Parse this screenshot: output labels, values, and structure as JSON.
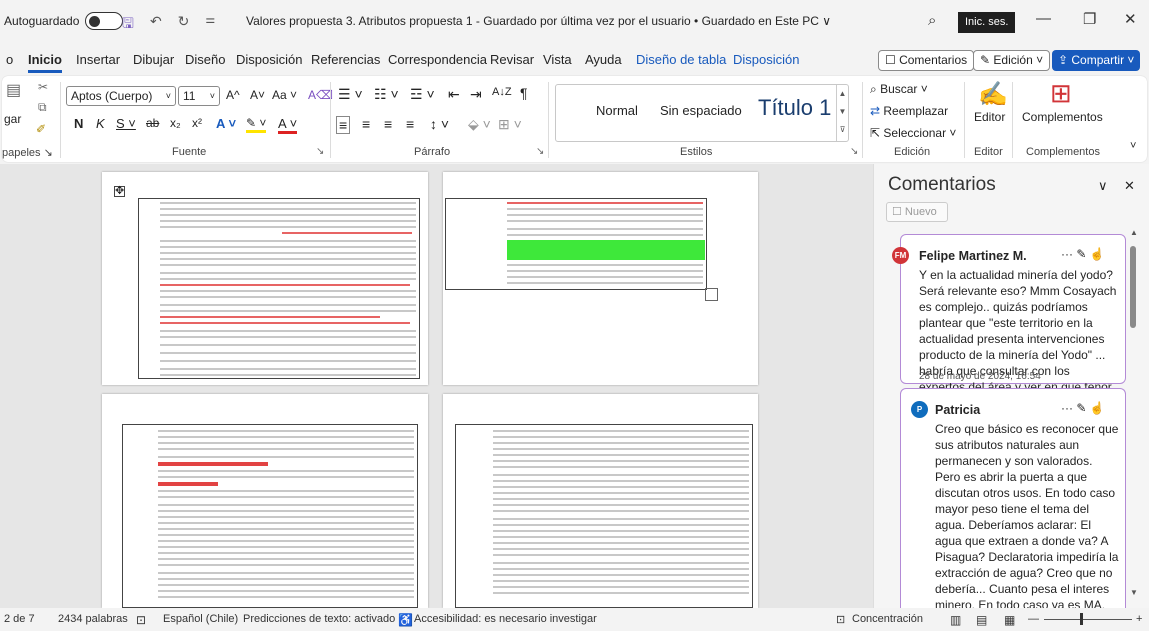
{
  "titlebar": {
    "autosave_label": "Autoguardado",
    "doc_title": "Valores propuesta 3. Atributos propuesta 1  -  Guardado por última vez por el usuario • Guardado en Este PC ∨",
    "signin": "Inic. ses.",
    "minimize": "—",
    "restore": "❐",
    "close": "✕",
    "search_icon": "⌕",
    "save_icon": "🖫",
    "undo_icon": "↶",
    "redo_icon": "↻",
    "more_icon": "⚌"
  },
  "tabs": {
    "items": [
      "o",
      "Inicio",
      "Insertar",
      "Dibujar",
      "Diseño",
      "Disposición",
      "Referencias",
      "Correspondencia",
      "Revisar",
      "Vista",
      "Ayuda"
    ],
    "context": [
      "Diseño de tabla",
      "Disposición"
    ],
    "comments_btn": "☐ Comentarios",
    "edit_btn": "✎ Edición ˅",
    "share_btn": "⇪ Compartir ˅"
  },
  "ribbon": {
    "clipboard": {
      "paste": "gar",
      "label": "papeles ↘"
    },
    "font": {
      "font_name": "Aptos (Cuerpo)",
      "font_size": "11",
      "grow": "A^",
      "shrink": "A˅",
      "case": "Aa ˅",
      "clear": "A⌫",
      "bold": "N",
      "italic": "K",
      "underline": "S ˅",
      "strike": "ab",
      "sub": "x₂",
      "sup": "x²",
      "effects": "A ˅",
      "highlight": "✎ ˅",
      "color": "A ˅",
      "label": "Fuente"
    },
    "paragraph": {
      "label": "Párrafo",
      "pilcrow": "¶",
      "sort": "A↓Z"
    },
    "styles": {
      "normal": "Normal",
      "no_spacing": "Sin espaciado",
      "title1": "Título 1",
      "label": "Estilos"
    },
    "editing": {
      "find": "Buscar ˅",
      "replace": "Reemplazar",
      "select": "Seleccionar ˅",
      "label": "Edición"
    },
    "editor": {
      "btn": "Editor",
      "label": "Editor"
    },
    "addins": {
      "btn": "Complementos",
      "label": "Complementos"
    }
  },
  "comments": {
    "title": "Comentarios",
    "new_btn": "☐ Nuevo",
    "collapse": "∨",
    "close": "✕",
    "items": [
      {
        "initials": "FM",
        "author": "Felipe Martinez M.",
        "text": "Y en la actualidad minería del yodo? Será relevante eso? Mmm Cosayach es complejo.. quizás podríamos plantear que \"este territorio en la actualidad presenta intervenciones producto de la minería del Yodo\" ... habría que consultar con los expertos del área y ver en que tenor lo ponemos..",
        "date": "28 de mayo de 2024, 16:54",
        "color": "#d13438"
      },
      {
        "initials": "P",
        "author": "Patricia",
        "text": "Creo que básico es reconocer que sus atributos naturales aun permanecen y son valorados. Pero es abrir la puerta a que discutan otros usos. En todo caso mayor peso tiene el tema del agua. Deberíamos aclarar: El agua que extraen a donde va? A Pisagua? Declaratoria impediría la extracción de agua? Creo que no debería... Cuanto pesa el interes minero. En todo caso ya es MA, por lo que de todas formas no",
        "color": "#0f6cbd"
      }
    ],
    "card_actions": "··· ✎ ☝"
  },
  "status": {
    "page": "2 de 7",
    "words": "2434 palabras",
    "lang": "Español (Chile)",
    "predictions": "Predicciones de texto: activado",
    "accessibility": "Accesibilidad: es necesario investigar",
    "focus": "Concentración",
    "zoom_minus": "—",
    "zoom_plus": "+"
  }
}
